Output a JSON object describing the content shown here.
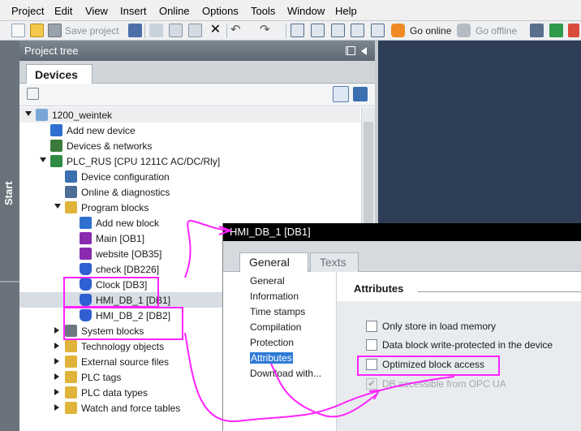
{
  "menu": [
    "Project",
    "Edit",
    "View",
    "Insert",
    "Online",
    "Options",
    "Tools",
    "Window",
    "Help"
  ],
  "toolbar": {
    "save_label": "Save project",
    "go_online_label": "Go online",
    "go_offline_label": "Go offline"
  },
  "start_label": "Start",
  "project_tree": {
    "title": "Project tree",
    "tab_label": "Devices",
    "items": [
      {
        "label": "1200_weintek",
        "expand": "down",
        "icon": "project-icon",
        "color": "#7aa6d6"
      },
      {
        "label": "Add new device",
        "expand": "none",
        "icon": "add-device-icon",
        "color": "#2f6fd0"
      },
      {
        "label": "Devices & networks",
        "expand": "none",
        "icon": "network-icon",
        "color": "#3a7a3a"
      },
      {
        "label": "PLC_RUS [CPU 1211C AC/DC/Rly]",
        "expand": "down",
        "icon": "plc-icon",
        "color": "#2f8a44"
      },
      {
        "label": "Device configuration",
        "expand": "none",
        "icon": "device-config-icon",
        "color": "#3b6fb0"
      },
      {
        "label": "Online & diagnostics",
        "expand": "none",
        "icon": "diagnostics-icon",
        "color": "#4d6e96"
      },
      {
        "label": "Program blocks",
        "expand": "down",
        "icon": "folder-icon",
        "color": "#e0b43a"
      },
      {
        "label": "Add new block",
        "expand": "none",
        "icon": "add-block-icon",
        "color": "#2f6fd0"
      },
      {
        "label": "Main [OB1]",
        "expand": "none",
        "icon": "ob-block-icon",
        "color": "#8a2bb0"
      },
      {
        "label": "website [OB35]",
        "expand": "none",
        "icon": "ob-block-icon",
        "color": "#8a2bb0"
      },
      {
        "label": "check [DB226]",
        "expand": "none",
        "icon": "db-block-icon",
        "color": "#2f5fd0"
      },
      {
        "label": "Clock [DB3]",
        "expand": "none",
        "icon": "db-block-icon",
        "color": "#2f5fd0"
      },
      {
        "label": "HMI_DB_1 [DB1]",
        "expand": "none",
        "icon": "db-block-icon",
        "color": "#2f5fd0"
      },
      {
        "label": "HMI_DB_2 [DB2]",
        "expand": "none",
        "icon": "db-block-icon",
        "color": "#2f5fd0"
      },
      {
        "label": "System blocks",
        "expand": "right",
        "icon": "system-blocks-icon",
        "color": "#6d7780"
      },
      {
        "label": "Technology objects",
        "expand": "right",
        "icon": "technology-icon",
        "color": "#e0b43a"
      },
      {
        "label": "External source files",
        "expand": "right",
        "icon": "folder-icon",
        "color": "#e0b43a"
      },
      {
        "label": "PLC tags",
        "expand": "right",
        "icon": "folder-icon",
        "color": "#e0b43a"
      },
      {
        "label": "PLC data types",
        "expand": "right",
        "icon": "folder-icon",
        "color": "#e0b43a"
      },
      {
        "label": "Watch and force tables",
        "expand": "right",
        "icon": "folder-icon",
        "color": "#e0b43a"
      }
    ]
  },
  "properties": {
    "title": "HMI_DB_1 [DB1]",
    "tabs": [
      "General",
      "Texts"
    ],
    "nav": [
      "General",
      "Information",
      "Time stamps",
      "Compilation",
      "Protection",
      "Attributes",
      "Download with..."
    ],
    "section_title": "Attributes",
    "checkboxes": [
      {
        "label": "Only store in load memory",
        "checked": false,
        "disabled": false
      },
      {
        "label": "Data block write-protected in the device",
        "checked": false,
        "disabled": false
      },
      {
        "label": "Optimized block access",
        "checked": false,
        "disabled": false
      },
      {
        "label": "DB accessible from OPC UA",
        "checked": true,
        "disabled": true
      }
    ]
  },
  "colors": {
    "annotation": "#ff22ff",
    "header_dark": "#5d6872",
    "selection": "#d8dde3"
  }
}
